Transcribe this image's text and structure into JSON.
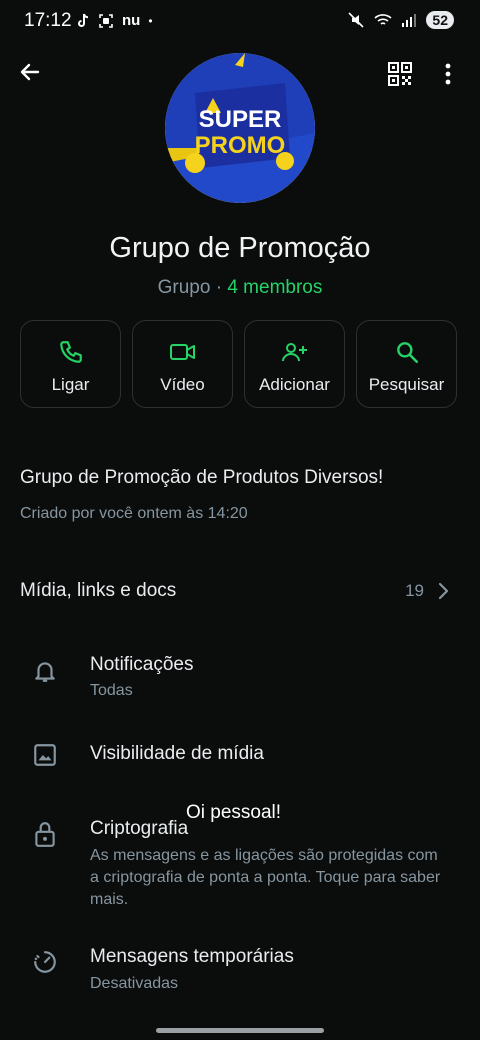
{
  "status_bar": {
    "time": "17:12",
    "left_icons": [
      "tiktok-icon",
      "screen-record-icon",
      "nu-icon",
      "dot-icon"
    ],
    "nu_label": "nu",
    "dot": "•",
    "battery": "52"
  },
  "header": {
    "back_icon": "back-arrow-icon",
    "qr_icon": "qr-code-icon",
    "more_icon": "more-vertical-icon"
  },
  "avatar": {
    "line1": "SUPER",
    "line2": "PROMO"
  },
  "group": {
    "name": "Grupo de Promoção",
    "type": "Grupo",
    "separator": " · ",
    "members": "4 membros"
  },
  "actions": [
    {
      "label": "Ligar",
      "icon": "phone-icon"
    },
    {
      "label": "Vídeo",
      "icon": "video-icon"
    },
    {
      "label": "Adicionar",
      "icon": "add-person-icon"
    },
    {
      "label": "Pesquisar",
      "icon": "search-icon"
    }
  ],
  "description": {
    "text": "Grupo de Promoção de Produtos Diversos!",
    "created": "Criado por você ontem às 14:20"
  },
  "media": {
    "title": "Mídia, links e docs",
    "count": "19"
  },
  "settings": [
    {
      "title": "Notificações",
      "subtitle": "Todas",
      "icon": "bell-icon"
    },
    {
      "title": "Visibilidade de mídia",
      "subtitle": "",
      "icon": "image-icon"
    },
    {
      "title": "Criptografia",
      "subtitle": "As mensagens e as ligações são protegidas com a criptografia de ponta a ponta. Toque para saber mais.",
      "icon": "lock-icon"
    },
    {
      "title": "Mensagens temporárias",
      "subtitle": "Desativadas",
      "icon": "timer-icon"
    }
  ],
  "overlay": {
    "text": "Oi pessoal!"
  },
  "colors": {
    "accent": "#25d366",
    "background": "#0b0c0c",
    "secondary_text": "#8696a0"
  }
}
